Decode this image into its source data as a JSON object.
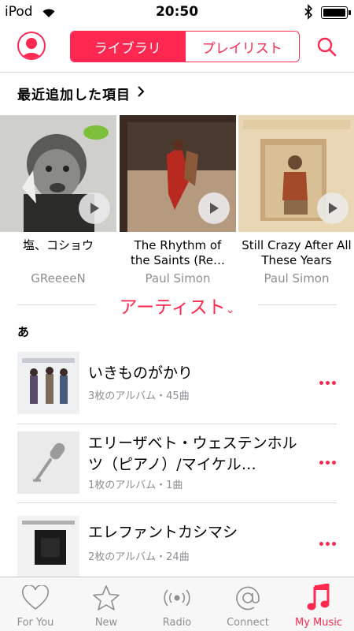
{
  "status_bar": {
    "carrier": "iPod",
    "time": "20:50"
  },
  "nav": {
    "segments": [
      "ライブラリ",
      "プレイリスト"
    ],
    "active_segment": "ライブラリ"
  },
  "recently_added": {
    "header": "最近追加した項目",
    "albums": [
      {
        "title": "塩、コショウ",
        "artist": "GReeeeN"
      },
      {
        "title": "The Rhythm of the Saints (Re…",
        "artist": "Paul Simon"
      },
      {
        "title": "Still Crazy After All These Years",
        "artist": "Paul Simon"
      }
    ]
  },
  "section": {
    "title": "アーティスト",
    "index_letter": "あ"
  },
  "artists": [
    {
      "name": "いきものがかり",
      "detail": "3枚のアルバム・45曲"
    },
    {
      "name": "エリーザベト・ウェステンホルツ（ピアノ）/マイケル…",
      "detail": "1枚のアルバム・1曲"
    },
    {
      "name": "エレファントカシマシ",
      "detail": "2枚のアルバム・24曲"
    }
  ],
  "tabs": [
    {
      "label": "For You",
      "icon": "heart-icon"
    },
    {
      "label": "New",
      "icon": "star-icon"
    },
    {
      "label": "Radio",
      "icon": "radio-icon"
    },
    {
      "label": "Connect",
      "icon": "at-icon"
    },
    {
      "label": "My Music",
      "icon": "music-note-icon"
    }
  ],
  "active_tab": "My Music",
  "colors": {
    "accent": "#fe2851",
    "secondary_text": "#8e8e93",
    "separator": "#d8d8d8"
  }
}
